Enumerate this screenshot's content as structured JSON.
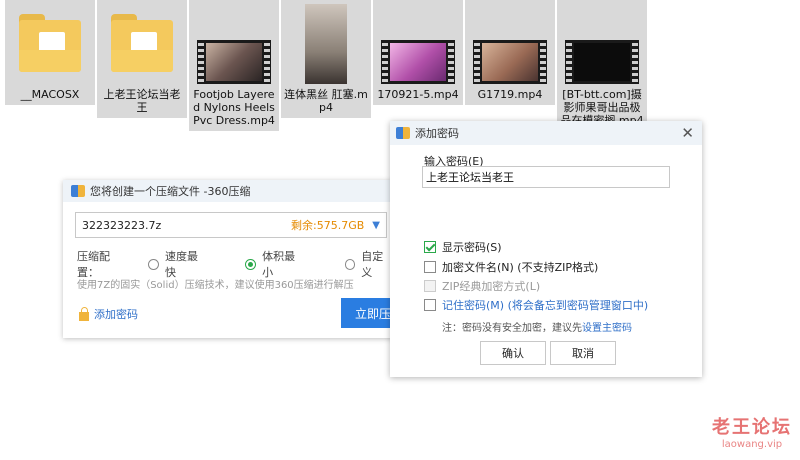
{
  "files": [
    {
      "name": "__MACOSX",
      "kind": "folder"
    },
    {
      "name": "上老王论坛当老王",
      "kind": "folder"
    },
    {
      "name": "Footjob Layered Nylons Heels Pvc Dress.mp4",
      "kind": "video"
    },
    {
      "name": "连体黑丝 肛塞.mp4",
      "kind": "image"
    },
    {
      "name": "170921-5.mp4",
      "kind": "video"
    },
    {
      "name": "G1719.mp4",
      "kind": "video"
    },
    {
      "name": "[BT-btt.com]摄影师果哥出品极品在模密搁.mp4",
      "kind": "video"
    }
  ],
  "compress_dialog": {
    "title": "您将创建一个压缩文件 -360压缩",
    "archive_name": "322323223.7z",
    "space_remaining": "剩余:575.7GB",
    "config_label": "压缩配置：",
    "options": [
      "速度最快",
      "体积最小",
      "自定义"
    ],
    "selected_option": "体积最小",
    "tip": "使用7Z的固实（Solid）压缩技术，建议使用360压缩进行解压",
    "add_password": "添加密码",
    "compress_now": "立即压缩"
  },
  "password_dialog": {
    "title": "添加密码",
    "input_label": "输入密码(E)",
    "password_value": "上老王论坛当老王",
    "show_password": "显示密码(S)",
    "encrypt_filenames": "加密文件名(N) (不支持ZIP格式)",
    "zip_classic": "ZIP经典加密方式(L)",
    "remember_password": "记住密码(M) (将会备忘到密码管理窗口中)",
    "note_prefix": "注：密码没有安全加密，建议先",
    "note_link": "设置主密码",
    "ok": "确认",
    "cancel": "取消"
  },
  "watermark": {
    "title": "老王论坛",
    "url": "laowang.vip"
  }
}
